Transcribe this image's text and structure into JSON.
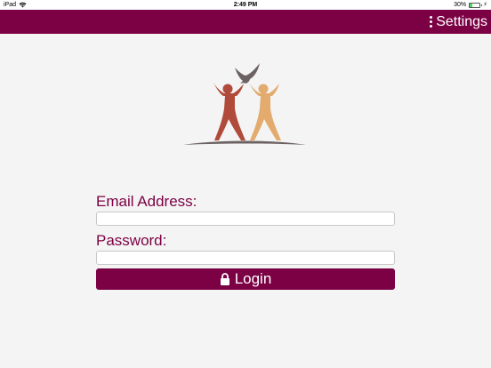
{
  "status_bar": {
    "device": "iPad",
    "time": "2:49 PM",
    "battery_percent": "30%",
    "battery_level": 0.3
  },
  "nav_bar": {
    "settings_label": "Settings",
    "color": "#7b0044"
  },
  "icons": {
    "wifi": "wifi-icon",
    "battery": "battery-icon",
    "menu": "vertical-dots-icon",
    "lock": "lock-icon",
    "logo": "dove-and-figures-logo"
  },
  "form": {
    "email_label": "Email Address:",
    "email_value": "",
    "password_label": "Password:",
    "password_value": "",
    "login_label": "Login"
  },
  "colors": {
    "accent": "#7b0044",
    "background": "#f4f4f4",
    "logo_figure_left": "#b04a3a",
    "logo_figure_right": "#e3ac6e",
    "logo_dove": "#6d6262",
    "logo_ground": "#6d6262"
  }
}
